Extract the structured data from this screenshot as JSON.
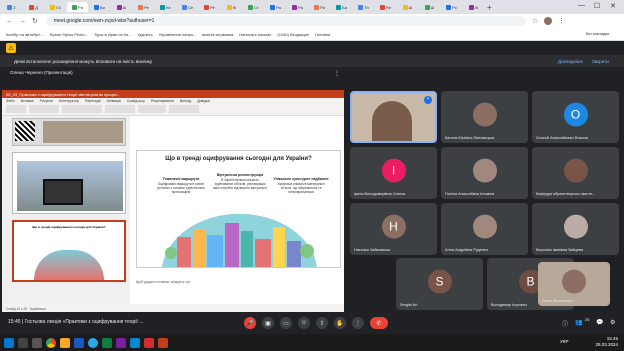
{
  "browser": {
    "tabs": [
      "Z",
      "Д",
      "ГА",
      "Ри",
      "Ви",
      "Ш",
      "Ре",
      "Ке",
      "Ce",
      "Ре",
      "Кl",
      "Ст",
      "Ра",
      "Ра",
      "Ра",
      "Ба",
      "Тh",
      "Re",
      "Ш",
      "Ш",
      "Рс",
      "Xt"
    ],
    "url": "meet.google.com/ewn-zvjxd-wbx?authuser=1",
    "bookmarks": [
      "Калібр на автобус!...",
      "Epson Stylus Photo...",
      "Туры в Иран из Ки...",
      "Удалить",
      "Управление папка...",
      "анкета керівника",
      "Написать письмо",
      "(1040) Входящие",
      "Головна"
    ],
    "all_bookmarks": "Всі закладки"
  },
  "infobar": {
    "text": "Деякі встановлені розширення можуть впливати на якість виклику",
    "details": "Докладніше",
    "close": "Закрити"
  },
  "presenter": "Олена Черненя (Презентація)",
  "presentation": {
    "file": "08_03_Практики з оцифрування теорії мистецтва як процес...",
    "tabs": [
      "Файл",
      "Вставка",
      "Рисунок",
      "Конструктор",
      "Переходи",
      "Анімація",
      "Слайд-шоу",
      "Рецензування",
      "Вигляд",
      "Довідка"
    ],
    "slide_title": "Що в тренді оцифрування сьогодні для України?",
    "columns": [
      {
        "heading": "Тематичні маршрути",
        "text": "Оцифровані маршрути в різних регіонах з готовою туристичною пропозицією"
      },
      {
        "heading": "Віртуальна реконструкція",
        "text": "В Україні велика кількість зруйнованих об'єктів, реставрацію яких потрібно відтворити віртуально"
      },
      {
        "heading": "Унікальне культурне надбання",
        "text": "Українські унікальні матеріальні об'єкти, що зберігаються та популяризуються"
      }
    ],
    "notes": "Щоб додати нотатки, клацніть тут",
    "status": "Слайд 10 з 28 · Українська",
    "thumb_title": "Що в тренді оцифрування сьогодні для України?"
  },
  "participants": [
    {
      "name": "Каганік Юріївна Липовецька",
      "initial": "",
      "color": "#8d6e63"
    },
    {
      "name": "Осокой Анатолійович Власов",
      "initial": "О",
      "color": "#1e88e5"
    },
    {
      "name": "Ірина Володимирівна Ситник",
      "initial": "І",
      "color": "#e91e63"
    },
    {
      "name": "Поліна Анатоліївна Істоміна",
      "initial": "",
      "color": "#a1887f"
    },
    {
      "name": "Кафедра образотворчого мисте...",
      "initial": "",
      "color": "#795548"
    },
    {
      "name": "Наталья Чайковська",
      "initial": "Н",
      "color": "#8d6e63"
    },
    {
      "name": "Алла Андріївна Руденко",
      "initial": "",
      "color": "#a1887f"
    },
    {
      "name": "Вероніка Іванівна Зайцева",
      "initial": "",
      "color": "#bcaaa4"
    },
    {
      "name": "Sergiei Ari",
      "initial": "S",
      "color": "#795548"
    },
    {
      "name": "Володимир Ігорович",
      "initial": "В",
      "color": "#6d4c41"
    },
    {
      "name": "Ольга Волнянськ...",
      "initial": "",
      "color": "#8d6e63"
    }
  ],
  "controls": {
    "time": "15:45",
    "meeting": "Гостьова лекція «Практики з оцифрування теорії ...",
    "end_call": "✆",
    "count": "25"
  },
  "taskbar": {
    "lang": "УКР",
    "clock_time": "15:45",
    "clock_date": "28.03.2024"
  }
}
